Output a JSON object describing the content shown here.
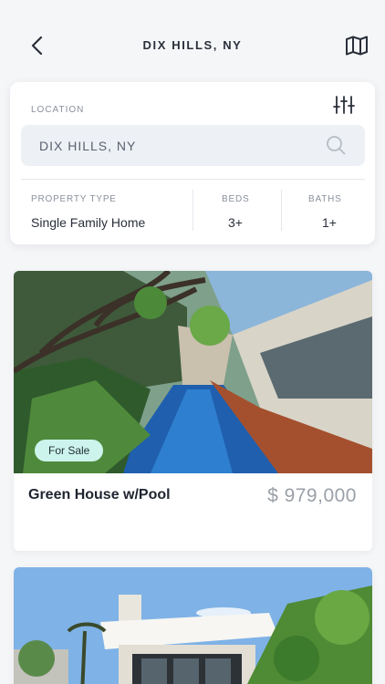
{
  "header": {
    "title": "DIX HILLS, NY"
  },
  "search": {
    "location_label": "LOCATION",
    "value": "DIX HILLS, NY"
  },
  "filters": {
    "property_type": {
      "label": "PROPERTY TYPE",
      "value": "Single Family Home"
    },
    "beds": {
      "label": "BEDS",
      "value": "3+"
    },
    "baths": {
      "label": "BATHS",
      "value": "1+"
    }
  },
  "listings": [
    {
      "badge": "For Sale",
      "name": "Green House w/Pool",
      "price": "$ 979,000"
    }
  ],
  "colors": {
    "badge_bg": "#cdf4ec",
    "background": "#f5f6f8",
    "price": "#9aa0a8"
  },
  "icons": [
    "back-arrow-icon",
    "map-icon",
    "sliders-icon",
    "search-icon"
  ]
}
